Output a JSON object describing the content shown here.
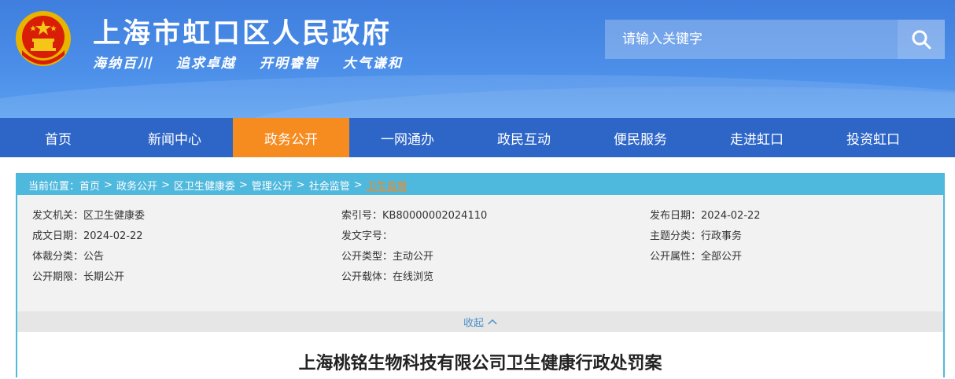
{
  "header": {
    "site_title": "上海市虹口区人民政府",
    "slogan": [
      "海纳百川",
      "追求卓越",
      "开明睿智",
      "大气谦和"
    ],
    "search_placeholder": "请输入关键字"
  },
  "nav": {
    "items": [
      "首页",
      "新闻中心",
      "政务公开",
      "一网通办",
      "政民互动",
      "便民服务",
      "走进虹口",
      "投资虹口"
    ],
    "active": "政务公开"
  },
  "breadcrumb": {
    "label": "当前位置：",
    "items": [
      "首页",
      "政务公开",
      "区卫生健康委",
      "管理公开",
      "社会监管",
      "卫生监督"
    ],
    "separator": ">"
  },
  "meta": {
    "rows": [
      [
        {
          "k": "发文机关：",
          "v": "区卫生健康委"
        },
        {
          "k": "索引号：",
          "v": "KB80000002024110"
        },
        {
          "k": "发布日期：",
          "v": "2024-02-22"
        }
      ],
      [
        {
          "k": "成文日期：",
          "v": "2024-02-22"
        },
        {
          "k": "发文字号：",
          "v": ""
        },
        {
          "k": "主题分类：",
          "v": "行政事务"
        }
      ],
      [
        {
          "k": "体裁分类：",
          "v": "公告"
        },
        {
          "k": "公开类型：",
          "v": "主动公开"
        },
        {
          "k": "公开属性：",
          "v": "全部公开"
        }
      ],
      [
        {
          "k": "公开期限：",
          "v": "长期公开"
        },
        {
          "k": "公开载体：",
          "v": "在线浏览"
        }
      ]
    ]
  },
  "collapse_label": "收起",
  "doc_title": "上海桃铭生物科技有限公司卫生健康行政处罚案",
  "colors": {
    "nav_bg": "#2e66c8",
    "active": "#f68b1f",
    "crumb_bg": "#4fb8dd",
    "header": "#4c8fe9"
  }
}
